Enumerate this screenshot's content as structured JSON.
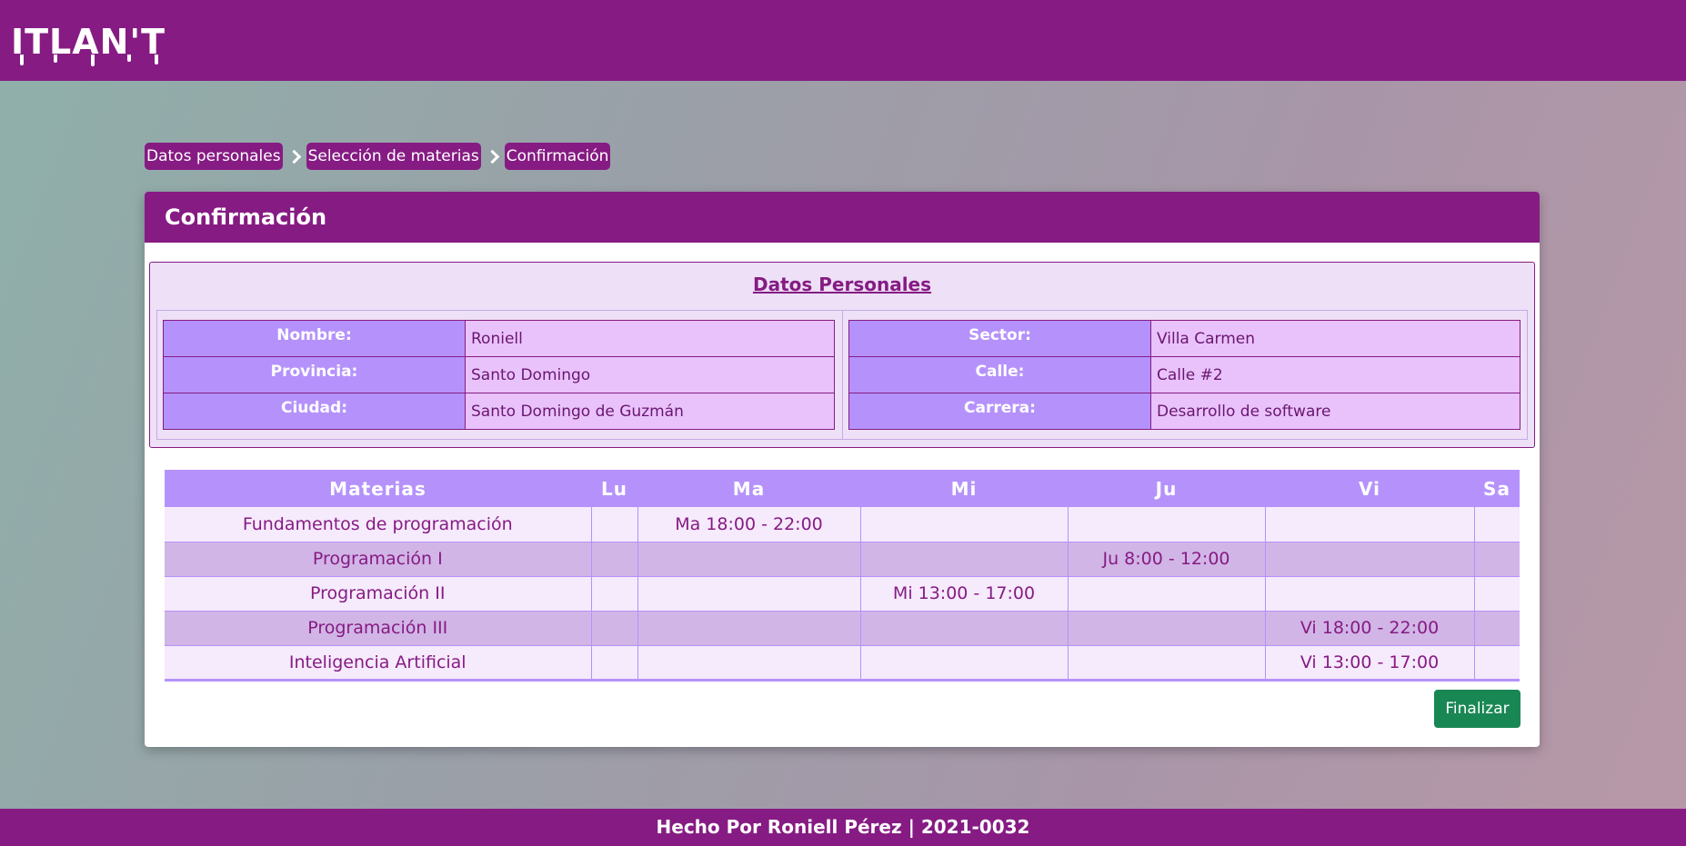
{
  "app": {
    "logo": "ITLAN'T"
  },
  "breadcrumb": {
    "items": [
      "Datos personales",
      "Selección de materias",
      "Confirmación"
    ]
  },
  "card": {
    "title": "Confirmación",
    "personal": {
      "title": "Datos Personales",
      "left": [
        {
          "label": "Nombre:",
          "value": "Roniell"
        },
        {
          "label": "Provincia:",
          "value": "Santo Domingo"
        },
        {
          "label": "Ciudad:",
          "value": "Santo Domingo de Guzmán"
        }
      ],
      "right": [
        {
          "label": "Sector:",
          "value": "Villa Carmen"
        },
        {
          "label": "Calle:",
          "value": "Calle #2"
        },
        {
          "label": "Carrera:",
          "value": "Desarrollo de software"
        }
      ]
    },
    "schedule": {
      "headers": [
        "Materias",
        "Lu",
        "Ma",
        "Mi",
        "Ju",
        "Vi",
        "Sa"
      ],
      "rows": [
        [
          "Fundamentos de programación",
          "",
          "Ma 18:00 - 22:00",
          "",
          "",
          "",
          ""
        ],
        [
          "Programación I",
          "",
          "",
          "",
          "Ju 8:00 - 12:00",
          "",
          ""
        ],
        [
          "Programación II",
          "",
          "",
          "Mi 13:00 - 17:00",
          "",
          "",
          ""
        ],
        [
          "Programación III",
          "",
          "",
          "",
          "",
          "Vi 18:00 - 22:00",
          ""
        ],
        [
          "Inteligencia Artificial",
          "",
          "",
          "",
          "",
          "Vi 13:00 - 17:00",
          ""
        ]
      ]
    },
    "finish_label": "Finalizar"
  },
  "footer": {
    "text": "Hecho Por Roniell Pérez | 2021-0032"
  },
  "colors": {
    "brand": "#861b83",
    "accent": "#b592fb",
    "success": "#198754"
  }
}
